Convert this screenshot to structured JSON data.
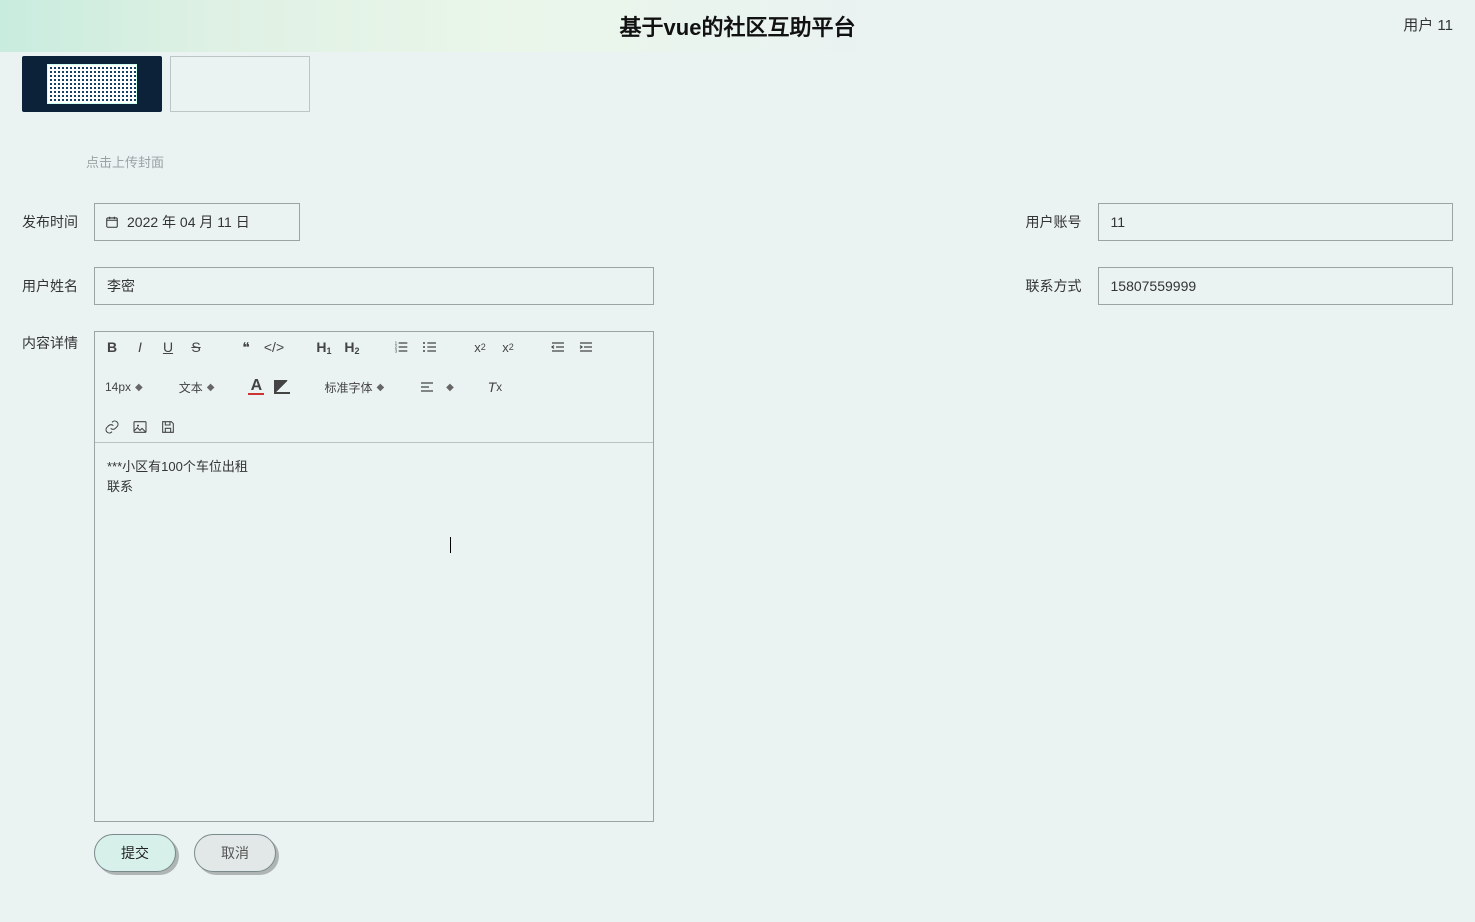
{
  "header": {
    "title": "基于vue的社区互助平台",
    "user_label": "用户 11"
  },
  "cover": {
    "hint": "点击上传封面"
  },
  "form": {
    "publish_time_label": "发布时间",
    "publish_time_value": "2022 年 04 月 11 日",
    "user_account_label": "用户账号",
    "user_account_value": "11",
    "user_name_label": "用户姓名",
    "user_name_value": "李密",
    "contact_label": "联系方式",
    "contact_value": "15807559999",
    "detail_label": "内容详情"
  },
  "editor": {
    "toolbar": {
      "font_size": "14px",
      "block_type": "文本",
      "font_family": "标准字体"
    },
    "content_line1": "***小区有100个车位出租",
    "content_line2": "联系"
  },
  "buttons": {
    "submit": "提交",
    "cancel": "取消"
  }
}
